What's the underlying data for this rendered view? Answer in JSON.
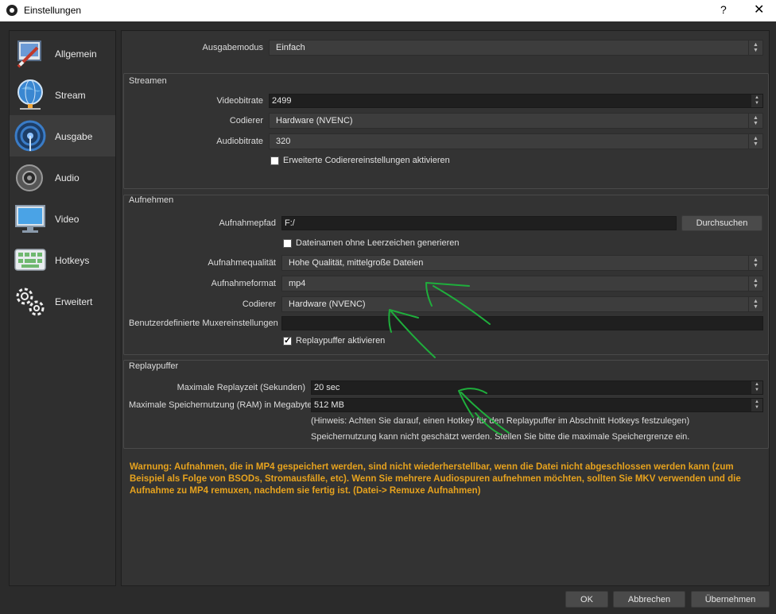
{
  "window": {
    "title": "Einstellungen",
    "help_label": "?",
    "close_label": "✕"
  },
  "sidebar": {
    "items": [
      {
        "label": "Allgemein",
        "icon": "settings-pen-icon"
      },
      {
        "label": "Stream",
        "icon": "globe-icon"
      },
      {
        "label": "Ausgabe",
        "icon": "broadcast-icon"
      },
      {
        "label": "Audio",
        "icon": "speaker-icon"
      },
      {
        "label": "Video",
        "icon": "monitor-icon"
      },
      {
        "label": "Hotkeys",
        "icon": "keyboard-icon"
      },
      {
        "label": "Erweitert",
        "icon": "gears-icon"
      }
    ],
    "active_index": 2
  },
  "output_mode": {
    "label": "Ausgabemodus",
    "value": "Einfach"
  },
  "streaming": {
    "title": "Streamen",
    "video_bitrate": {
      "label": "Videobitrate",
      "value": "2499"
    },
    "encoder": {
      "label": "Codierer",
      "value": "Hardware (NVENC)"
    },
    "audio_bitrate": {
      "label": "Audiobitrate",
      "value": "320"
    },
    "advanced_encoder": {
      "label": "Erweiterte Codierereinstellungen aktivieren",
      "checked": false
    }
  },
  "recording": {
    "title": "Aufnehmen",
    "path": {
      "label": "Aufnahmepfad",
      "value": "F:/"
    },
    "browse_label": "Durchsuchen",
    "no_spaces": {
      "label": "Dateinamen ohne Leerzeichen generieren",
      "checked": false
    },
    "quality": {
      "label": "Aufnahmequalität",
      "value": "Hohe Qualität, mittelgroße Dateien"
    },
    "format": {
      "label": "Aufnahmeformat",
      "value": "mp4"
    },
    "encoder": {
      "label": "Codierer",
      "value": "Hardware (NVENC)"
    },
    "muxer": {
      "label": "Benutzerdefinierte Muxereinstellungen",
      "value": ""
    },
    "replay_buffer": {
      "label": "Replaypuffer aktivieren",
      "checked": true
    }
  },
  "replay": {
    "title": "Replaypuffer",
    "max_time": {
      "label": "Maximale Replayzeit (Sekunden)",
      "value": "20 sec"
    },
    "max_memory": {
      "label": "Maximale Speichernutzung (RAM) in Megabyte",
      "value": "512 MB"
    },
    "hint": "(Hinweis: Achten Sie darauf, einen Hotkey für den Replaypuffer im Abschnitt Hotkeys festzulegen)",
    "memory_note": "Speichernutzung kann nicht geschätzt werden.  Stellen Sie bitte die maximale Speichergrenze ein."
  },
  "warning": "Warnung: Aufnahmen, die in MP4 gespeichert werden, sind nicht wiederherstellbar, wenn die Datei nicht abgeschlossen werden kann (zum Beispiel als Folge von BSODs, Stromausfälle, etc). Wenn Sie mehrere Audiospuren aufnehmen möchten, sollten Sie MKV verwenden und die Aufnahme zu MP4 remuxen, nachdem sie fertig ist. (Datei-> Remuxe Aufnahmen)",
  "footer": {
    "ok_label": "OK",
    "cancel_label": "Abbrechen",
    "apply_label": "Übernehmen"
  },
  "colors": {
    "warning": "#e6a21e",
    "annotation": "#1fae3c",
    "panel": "#333333"
  }
}
